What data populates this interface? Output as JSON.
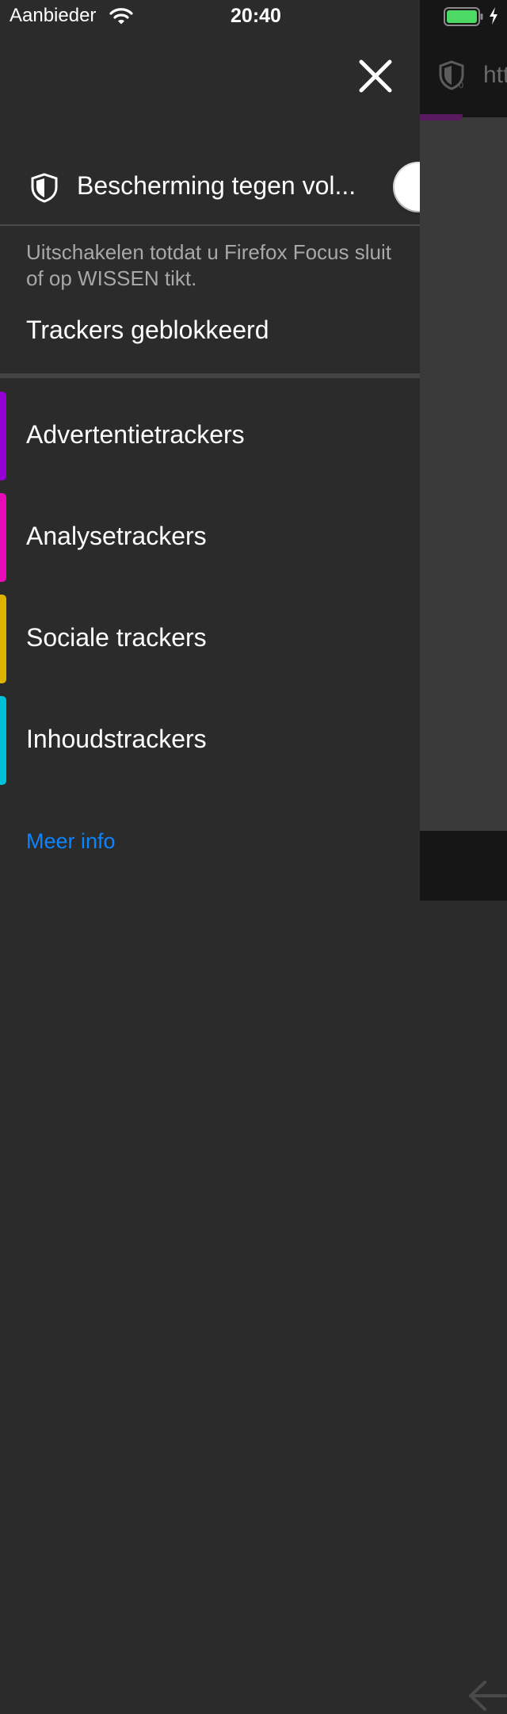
{
  "status_bar": {
    "carrier": "Aanbieder",
    "time": "20:40",
    "battery_color": "#4cd964"
  },
  "background_browser": {
    "url_fragment": "htt",
    "progress_color": "#5a1a60"
  },
  "panel": {
    "close_icon": "close-icon",
    "protection": {
      "label": "Bescherming tegen vol...",
      "icon": "shield-icon",
      "toggle_on": false
    },
    "description": "Uitschakelen totdat u Firefox Focus sluit of op WISSEN tikt.",
    "blocked_heading": "Trackers geblokkeerd",
    "trackers": [
      {
        "label": "Advertentietrackers",
        "color": "#9400d3"
      },
      {
        "label": "Analysetrackers",
        "color": "#e80ab6"
      },
      {
        "label": "Sociale trackers",
        "color": "#dcb300"
      },
      {
        "label": "Inhoudstrackers",
        "color": "#00c0d8"
      }
    ],
    "more_info": "Meer info",
    "link_color": "#0a84ff"
  }
}
